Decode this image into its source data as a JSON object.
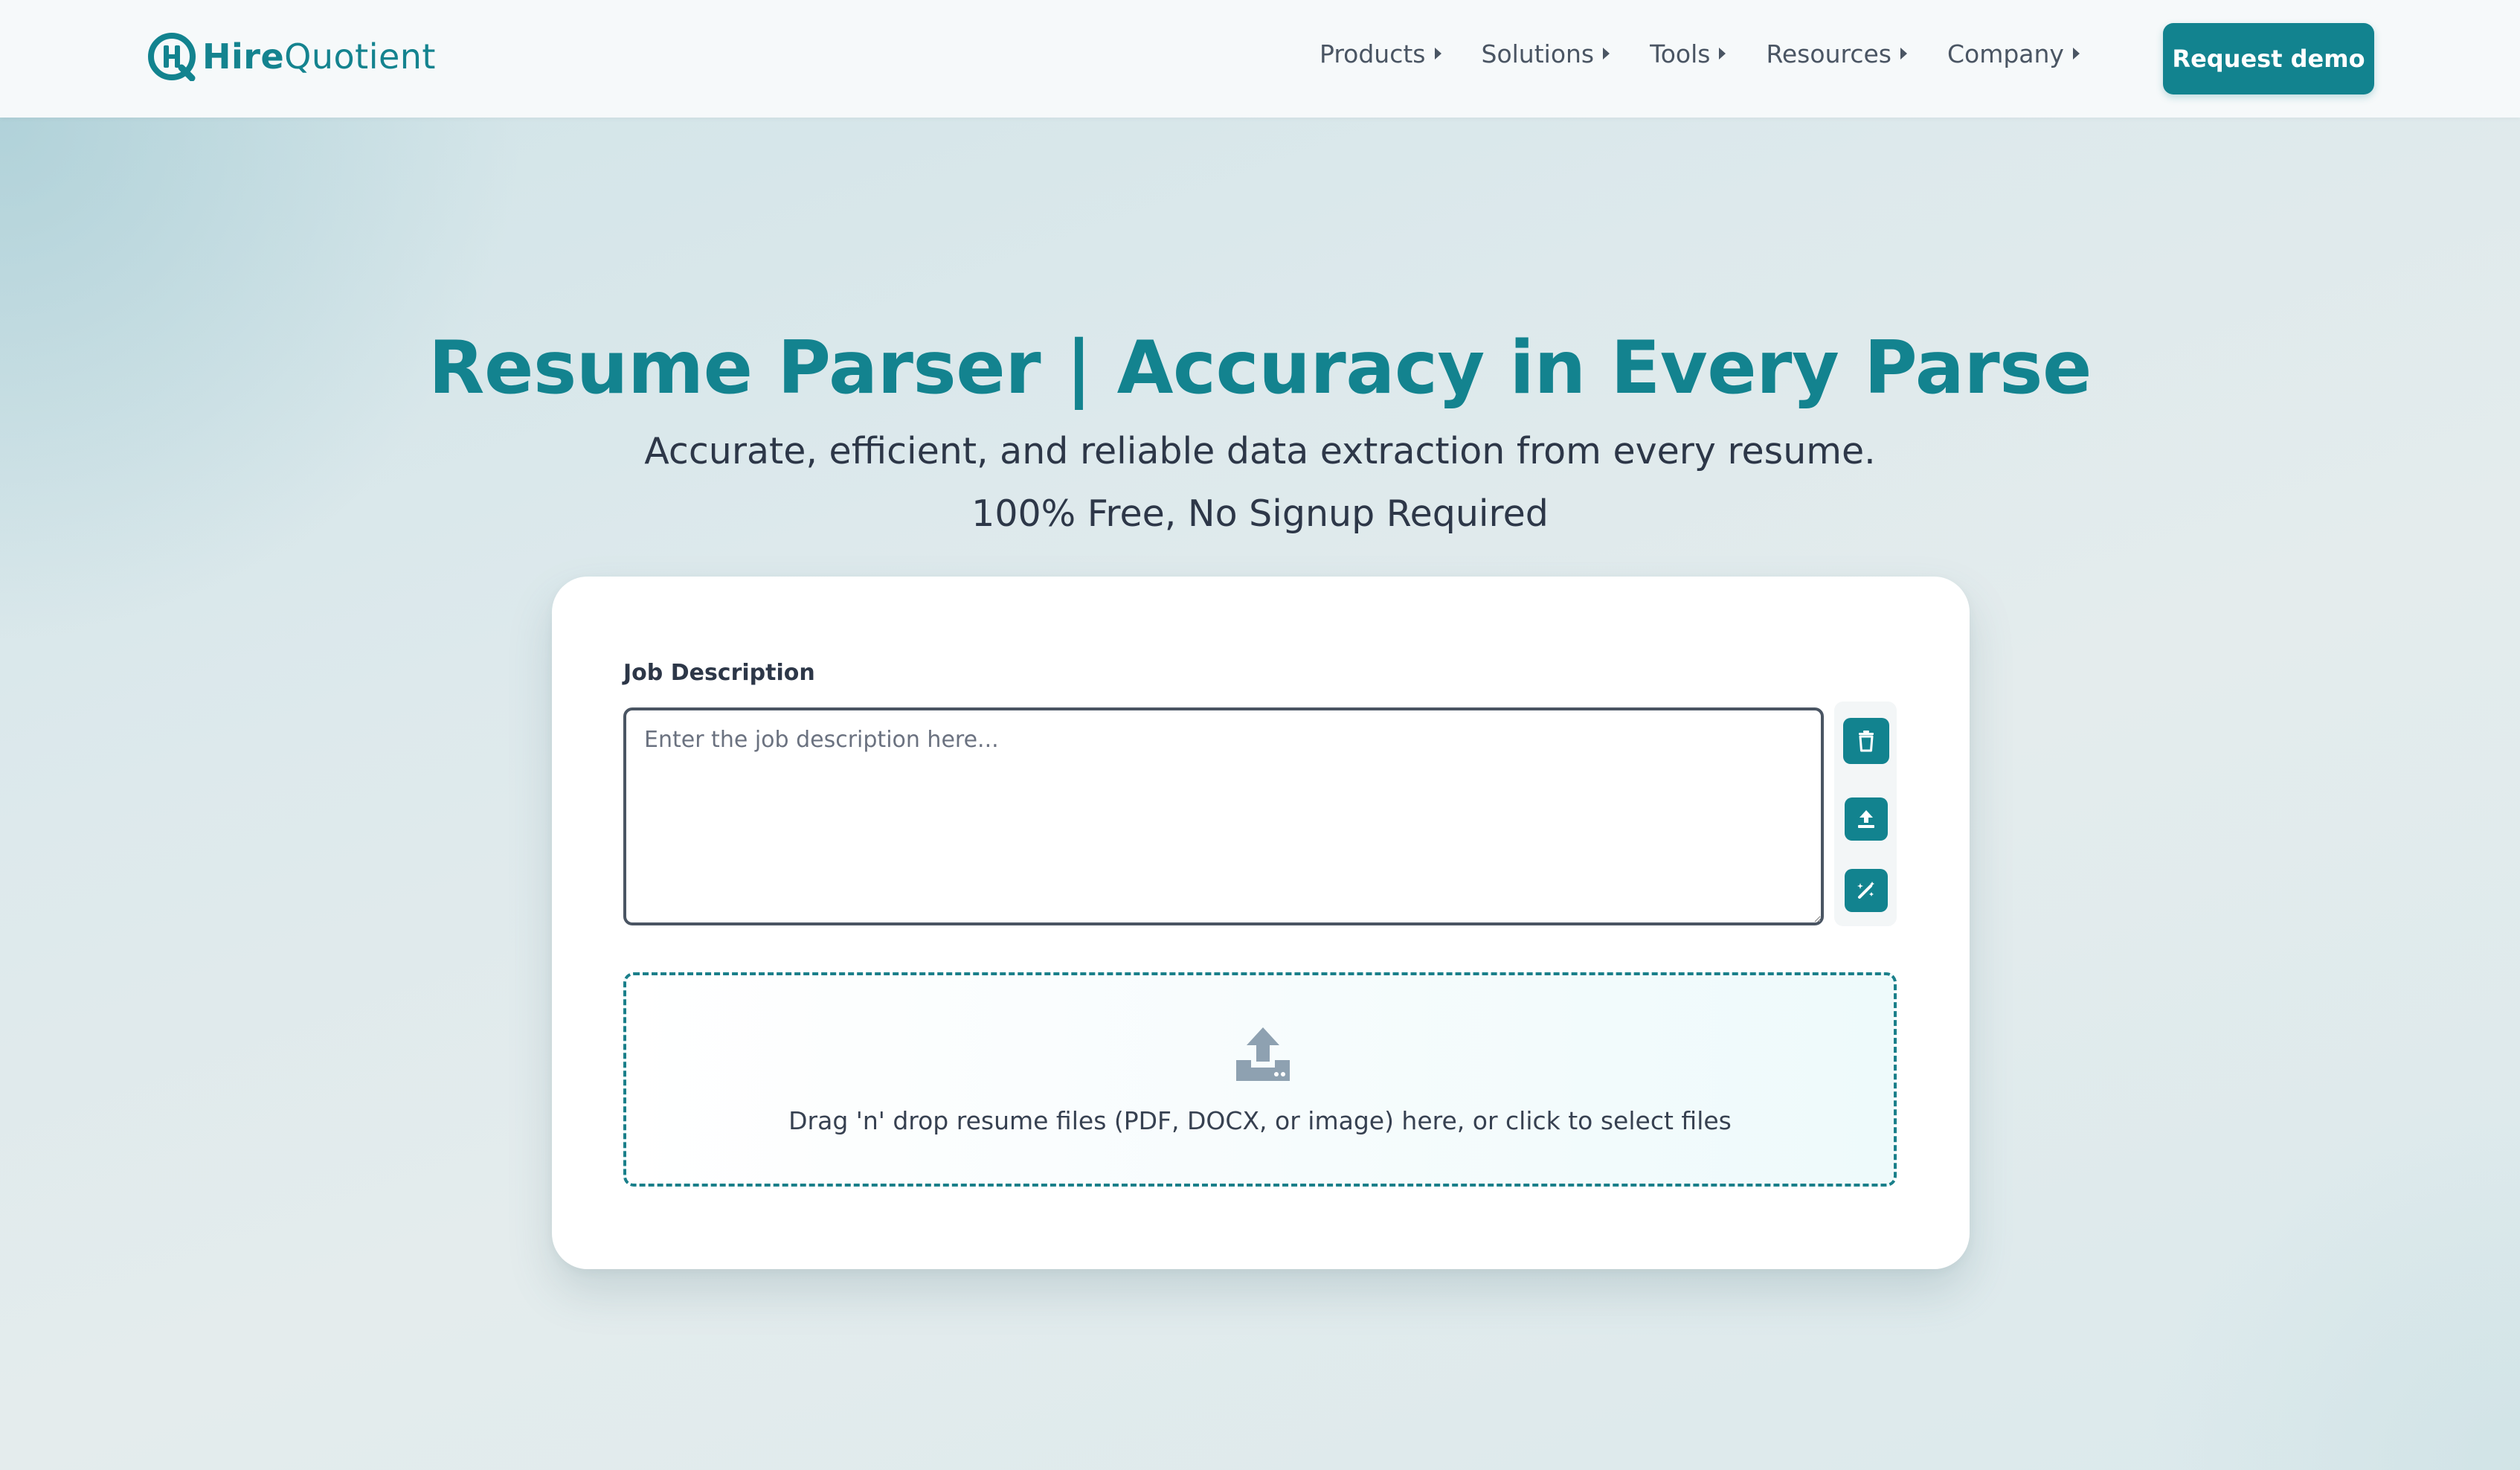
{
  "header": {
    "logo": {
      "bold": "Hire",
      "regular": "Quotient",
      "icon": "hq-logo-icon"
    },
    "nav": [
      {
        "label": "Products",
        "icon": "caret-right-icon"
      },
      {
        "label": "Solutions",
        "icon": "caret-right-icon"
      },
      {
        "label": "Tools",
        "icon": "caret-right-icon"
      },
      {
        "label": "Resources",
        "icon": "caret-right-icon"
      },
      {
        "label": "Company",
        "icon": "caret-right-icon"
      }
    ],
    "cta_label": "Request demo"
  },
  "hero": {
    "title": "Resume Parser | Accuracy in Every Parse",
    "subtitle": "Accurate, efficient, and reliable data extraction from every resume.",
    "free_note": "100% Free, No Signup Required"
  },
  "form": {
    "jd_label": "Job Description",
    "jd_value": "",
    "jd_placeholder": "Enter the job description here...",
    "tools": [
      {
        "name": "delete",
        "icon": "trash-icon"
      },
      {
        "name": "upload",
        "icon": "upload-icon"
      },
      {
        "name": "auto-generate",
        "icon": "magic-wand-icon"
      }
    ],
    "dropzone_text": "Drag 'n' drop resume files (PDF, DOCX, or image) here, or click to select files",
    "dropzone_icon": "upload-tray-icon"
  },
  "colors": {
    "brand": "#12838f",
    "text": "#2d3748",
    "card": "#ffffff"
  }
}
